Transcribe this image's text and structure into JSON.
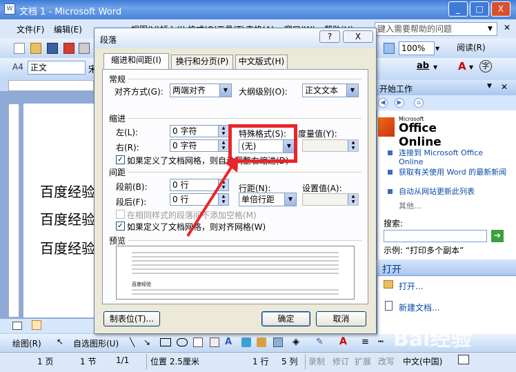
{
  "window": {
    "title": "文档 1 - Microsoft Word",
    "min": "_",
    "max": "□",
    "close": "X"
  },
  "menu": {
    "items": [
      "文件(F)",
      "编辑(E)",
      "视图(V)",
      "插入(I)",
      "格式(O)",
      "工具(T)",
      "表格(A)",
      "窗口(W)",
      "帮助(H)"
    ],
    "help_placeholder": "键入需要帮助的问题"
  },
  "toolbar": {
    "zoom": "100%",
    "read": "阅读(R)",
    "style": "正文",
    "font": "宋"
  },
  "document": {
    "lines": [
      "百度经验",
      "百度经验",
      "百度经验"
    ]
  },
  "taskpane": {
    "title": "开始工作",
    "logo_small": "Microsoft",
    "logo_big": "Office Online",
    "links": [
      "连接到 Microsoft Office Online",
      "获取有关使用 Word 的最新新闻",
      "自动从网站更新此列表"
    ],
    "other": "其他...",
    "search_label": "搜索:",
    "example": "示例: “打印多个副本”",
    "open_title": "打开",
    "open_link": "打开...",
    "new_doc": "新建文档..."
  },
  "dialog": {
    "title": "段落",
    "help": "?",
    "close": "X",
    "tabs": [
      "缩进和间距(I)",
      "换行和分页(P)",
      "中文版式(H)"
    ],
    "general": {
      "heading": "常规",
      "align_label": "对齐方式(G):",
      "align_value": "两端对齐",
      "outline_label": "大纲级别(O):",
      "outline_value": "正文文本"
    },
    "indent": {
      "heading": "缩进",
      "left_label": "左(L):",
      "left_value": "0 字符",
      "right_label": "右(R):",
      "right_value": "0 字符",
      "special_label": "特殊格式(S):",
      "special_value": "(无)",
      "measure_label": "度量值(Y):",
      "grid_check": "如果定义了文档网格，则自动调整右缩进(D)"
    },
    "spacing": {
      "heading": "间距",
      "before_label": "段前(B):",
      "before_value": "0 行",
      "after_label": "段后(F):",
      "after_value": "0 行",
      "line_label": "行距(N):",
      "line_value": "单倍行距",
      "at_label": "设置值(A):",
      "no_space_check": "在相同样式的段落间不添加空格(M)",
      "snap_check": "如果定义了文档网格，则对齐网格(W)"
    },
    "preview": {
      "heading": "预览",
      "sample": "百度经验"
    },
    "buttons": {
      "tabs": "制表位(T)...",
      "ok": "确定",
      "cancel": "取消"
    }
  },
  "drawbar": {
    "draw": "绘图(R)",
    "autoshape": "自选图形(U)"
  },
  "status": {
    "page": "1 页",
    "section": "1 节",
    "pages": "1/1",
    "position": "位置 2.5厘米",
    "line": "1 行",
    "col": "5 列",
    "rec": "录制",
    "rev": "修订",
    "ext": "扩展",
    "ovr": "改写",
    "lang": "中文(中国)"
  },
  "watermark": "Bai经验",
  "colors": {
    "accent": "#e8262a",
    "title_bar": "#3f7bd6",
    "link": "#0a4aa8"
  }
}
